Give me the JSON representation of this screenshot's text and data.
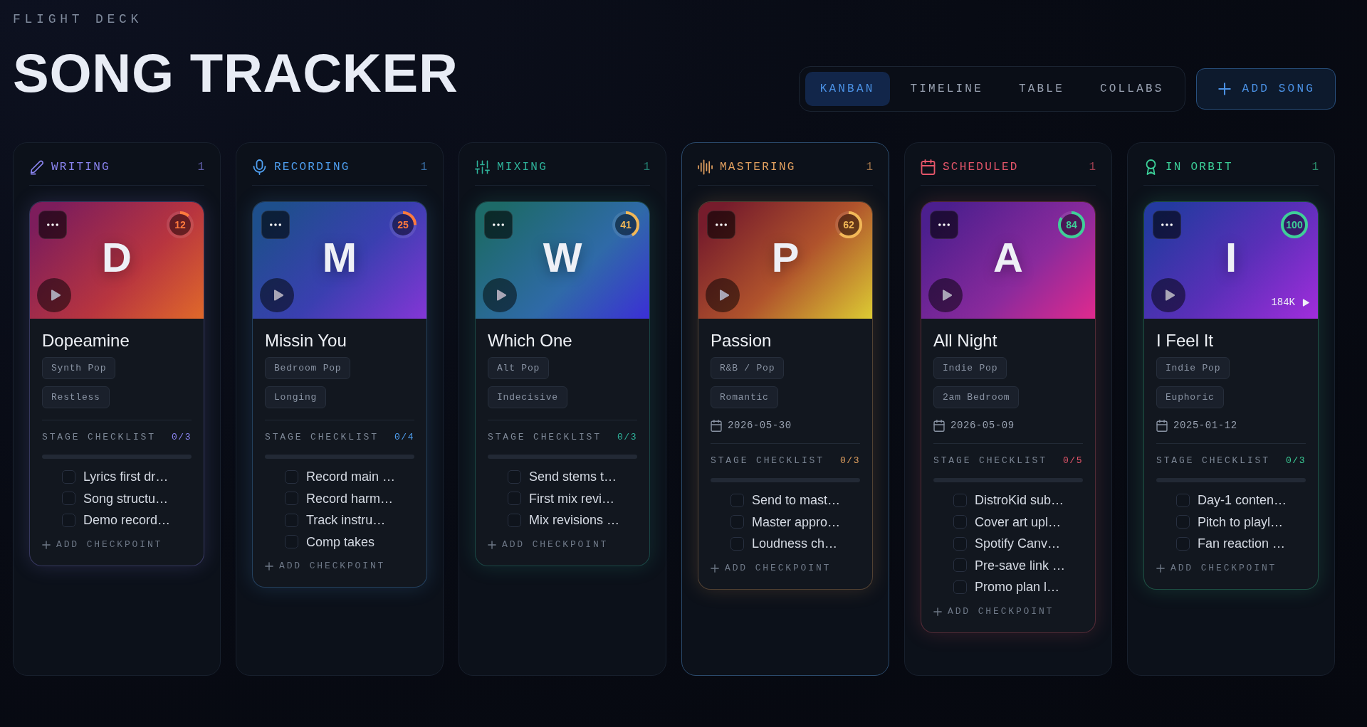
{
  "header": {
    "eyebrow": "FLIGHT DECK",
    "title": "SONG TRACKER"
  },
  "view_tabs": [
    {
      "label": "KANBAN",
      "selected": true
    },
    {
      "label": "TIMELINE",
      "selected": false
    },
    {
      "label": "TABLE",
      "selected": false
    },
    {
      "label": "COLLABS",
      "selected": false
    }
  ],
  "add_song_button": "ADD SONG",
  "columns": [
    {
      "kind": "writing",
      "label": "WRITING",
      "count": "1",
      "color": "#8b85f2",
      "highlighted": false,
      "cards": [
        {
          "letter": "D",
          "progress": {
            "level": 0.12,
            "reading": "12"
          },
          "title": "Dopeamine",
          "tags": [
            "Synth Pop",
            "Restless"
          ],
          "checklist": {
            "label": "STAGE CHECKLIST",
            "count": "0/3",
            "items": [
              {
                "text": "Lyrics first dr…",
                "checked": false
              },
              {
                "text": "Song structu…",
                "checked": false
              },
              {
                "text": "Demo record…",
                "checked": false
              }
            ]
          },
          "add_checkpoint": "ADD CHECKPOINT"
        }
      ]
    },
    {
      "kind": "recording",
      "label": "RECORDING",
      "count": "1",
      "color": "#4f9ff0",
      "highlighted": false,
      "cards": [
        {
          "letter": "M",
          "progress": {
            "level": 0.25,
            "reading": "25"
          },
          "title": "Missin You",
          "tags": [
            "Bedroom Pop",
            "Longing"
          ],
          "checklist": {
            "label": "STAGE CHECKLIST",
            "count": "0/4",
            "items": [
              {
                "text": "Record main …",
                "checked": false
              },
              {
                "text": "Record harm…",
                "checked": false
              },
              {
                "text": "Track instru…",
                "checked": false
              },
              {
                "text": "Comp takes",
                "checked": false
              }
            ]
          },
          "add_checkpoint": "ADD CHECKPOINT"
        }
      ]
    },
    {
      "kind": "mixing",
      "label": "MIXING",
      "count": "1",
      "color": "#2fb39b",
      "highlighted": false,
      "cards": [
        {
          "letter": "W",
          "progress": {
            "level": 0.41,
            "reading": "41"
          },
          "title": "Which One",
          "tags": [
            "Alt Pop",
            "Indecisive"
          ],
          "checklist": {
            "label": "STAGE CHECKLIST",
            "count": "0/3",
            "items": [
              {
                "text": "Send stems t…",
                "checked": false
              },
              {
                "text": "First mix revi…",
                "checked": false
              },
              {
                "text": "Mix revisions …",
                "checked": false
              }
            ]
          },
          "add_checkpoint": "ADD CHECKPOINT"
        }
      ]
    },
    {
      "kind": "mastering",
      "label": "MASTERING",
      "count": "1",
      "color": "#e3a160",
      "highlighted": true,
      "cards": [
        {
          "letter": "P",
          "progress": {
            "level": 0.62,
            "reading": "62"
          },
          "title": "Passion",
          "tags": [
            "R&B / Pop",
            "Romantic"
          ],
          "date": "2026-05-30",
          "checklist": {
            "label": "STAGE CHECKLIST",
            "count": "0/3",
            "items": [
              {
                "text": "Send to mast…",
                "checked": false
              },
              {
                "text": "Master appro…",
                "checked": false
              },
              {
                "text": "Loudness ch…",
                "checked": false
              }
            ]
          },
          "add_checkpoint": "ADD CHECKPOINT"
        }
      ]
    },
    {
      "kind": "scheduled",
      "label": "SCHEDULED",
      "count": "1",
      "color": "#e5566a",
      "highlighted": false,
      "cards": [
        {
          "letter": "A",
          "progress": {
            "level": 0.84,
            "reading": "84"
          },
          "title": "All Night",
          "tags": [
            "Indie Pop",
            "2am Bedroom"
          ],
          "date": "2026-05-09",
          "checklist": {
            "label": "STAGE CHECKLIST",
            "count": "0/5",
            "items": [
              {
                "text": "DistroKid sub…",
                "checked": false
              },
              {
                "text": "Cover art upl…",
                "checked": false
              },
              {
                "text": "Spotify Canv…",
                "checked": false
              },
              {
                "text": "Pre-save link …",
                "checked": false
              },
              {
                "text": "Promo plan l…",
                "checked": false
              }
            ]
          },
          "add_checkpoint": "ADD CHECKPOINT"
        }
      ]
    },
    {
      "kind": "orbit",
      "label": "IN ORBIT",
      "count": "1",
      "color": "#3ccf98",
      "highlighted": false,
      "cards": [
        {
          "letter": "I",
          "progress": {
            "level": 1,
            "reading": "100"
          },
          "plays": "184K",
          "title": "I Feel It",
          "tags": [
            "Indie Pop",
            "Euphoric"
          ],
          "date": "2025-01-12",
          "checklist": {
            "label": "STAGE CHECKLIST",
            "count": "0/3",
            "items": [
              {
                "text": "Day-1 conten…",
                "checked": false
              },
              {
                "text": "Pitch to playl…",
                "checked": false
              },
              {
                "text": "Fan reaction …",
                "checked": false
              }
            ]
          },
          "add_checkpoint": "ADD CHECKPOINT"
        }
      ]
    }
  ]
}
